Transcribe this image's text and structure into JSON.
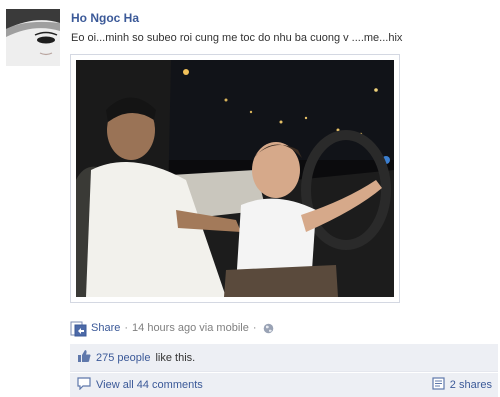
{
  "post": {
    "author": "Ho Ngoc Ha",
    "message": "Eo oi...minh so subeo roi cung me toc do nhu ba cuong v ....me...hix",
    "share_label": "Share",
    "separator": "·",
    "timestamp": "14 hours ago via mobile",
    "likes_count": "275 people",
    "likes_suffix": "like this.",
    "view_comments": "View all 44 comments",
    "shares": "2 shares"
  },
  "icons": {
    "share": "share-icon",
    "globe": "globe-icon",
    "like": "thumbs-up-icon",
    "comment": "comment-icon",
    "shares": "shares-icon"
  },
  "colors": {
    "link": "#3b5998",
    "muted": "#808080",
    "panel": "#edeff4"
  }
}
